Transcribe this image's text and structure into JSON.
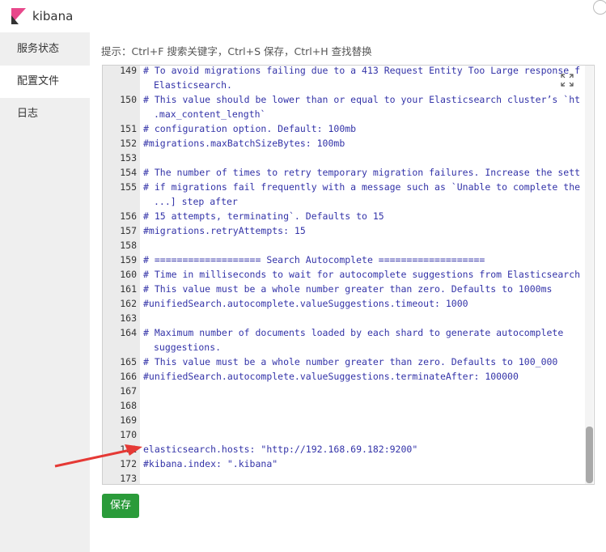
{
  "app": {
    "title": "kibana",
    "logo_color": "#e8488b"
  },
  "sidebar": {
    "items": [
      {
        "label": "服务状态",
        "active": false
      },
      {
        "label": "配置文件",
        "active": true
      },
      {
        "label": "日志",
        "active": false
      }
    ]
  },
  "hint": "提示：Ctrl+F 搜索关键字，Ctrl+S 保存，Ctrl+H 查找替换",
  "editor": {
    "lines": [
      {
        "num": "149",
        "text": "# To avoid migrations failing due to a 413 Request Entity Too Large response from"
      },
      {
        "num": "",
        "text": "Elasticsearch."
      },
      {
        "num": "150",
        "text": "# This value should be lower than or equal to your Elasticsearch cluster’s `http"
      },
      {
        "num": "",
        "text": ".max_content_length`"
      },
      {
        "num": "151",
        "text": "# configuration option. Default: 100mb"
      },
      {
        "num": "152",
        "text": "#migrations.maxBatchSizeBytes: 100mb"
      },
      {
        "num": "153",
        "text": ""
      },
      {
        "num": "154",
        "text": "# The number of times to retry temporary migration failures. Increase the setting"
      },
      {
        "num": "155",
        "text": "# if migrations fail frequently with a message such as `Unable to complete the ["
      },
      {
        "num": "",
        "text": "...] step after"
      },
      {
        "num": "156",
        "text": "# 15 attempts, terminating`. Defaults to 15"
      },
      {
        "num": "157",
        "text": "#migrations.retryAttempts: 15"
      },
      {
        "num": "158",
        "text": ""
      },
      {
        "num": "159",
        "text": "# =================== Search Autocomplete ==================="
      },
      {
        "num": "160",
        "text": "# Time in milliseconds to wait for autocomplete suggestions from Elasticsearch."
      },
      {
        "num": "161",
        "text": "# This value must be a whole number greater than zero. Defaults to 1000ms"
      },
      {
        "num": "162",
        "text": "#unifiedSearch.autocomplete.valueSuggestions.timeout: 1000"
      },
      {
        "num": "163",
        "text": ""
      },
      {
        "num": "164",
        "text": "# Maximum number of documents loaded by each shard to generate autocomplete"
      },
      {
        "num": "",
        "text": "suggestions."
      },
      {
        "num": "165",
        "text": "# This value must be a whole number greater than zero. Defaults to 100_000"
      },
      {
        "num": "166",
        "text": "#unifiedSearch.autocomplete.valueSuggestions.terminateAfter: 100000"
      },
      {
        "num": "167",
        "text": ""
      },
      {
        "num": "168",
        "text": ""
      },
      {
        "num": "169",
        "text": ""
      },
      {
        "num": "170",
        "text": ""
      },
      {
        "num": "171",
        "text": "elasticsearch.hosts: \"http://192.168.69.182:9200\""
      },
      {
        "num": "172",
        "text": "#kibana.index: \".kibana\""
      },
      {
        "num": "173",
        "text": ""
      }
    ]
  },
  "save_label": "保存",
  "colors": {
    "accent": "#2a9b3a",
    "arrow": "#e53935",
    "code": "#3333a8"
  }
}
